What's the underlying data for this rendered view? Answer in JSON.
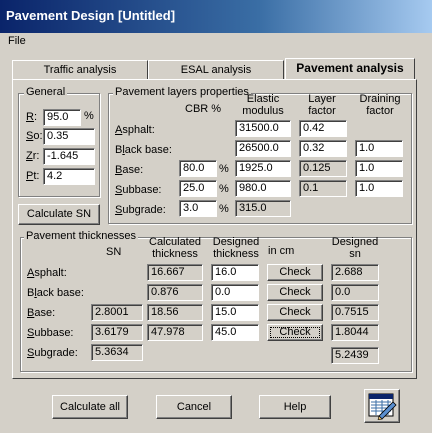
{
  "window": {
    "title": "Pavement Design [Untitled]"
  },
  "menu": {
    "file": "File"
  },
  "tabs": [
    "Traffic analysis",
    "ESAL analysis",
    "Pavement analysis"
  ],
  "general": {
    "title": "General",
    "fields": [
      {
        "label": "R:",
        "value": "95.0",
        "unit": "%"
      },
      {
        "label": "So:",
        "value": "0.35"
      },
      {
        "label": "Zr:",
        "value": "-1.645"
      },
      {
        "label": "Pt:",
        "value": "4.2"
      }
    ],
    "calc_sn_button": "Calculate SN"
  },
  "layers": {
    "title": "Pavement layers properties",
    "headers": {
      "cbr": "CBR %",
      "elastic": "Elastic modulus",
      "layer_factor": "Layer factor",
      "draining_factor": "Draining factor"
    },
    "rows": [
      {
        "name": "Asphalt:",
        "cbr": "",
        "elastic": "31500.0",
        "layer_factor": "0.42",
        "draining": ""
      },
      {
        "name": "Black base:",
        "cbr": "",
        "elastic": "26500.0",
        "layer_factor": "0.32",
        "draining": "1.0"
      },
      {
        "name": "Base:",
        "cbr": "80.0",
        "elastic": "1925.0",
        "layer_factor": "0.125",
        "draining": "1.0"
      },
      {
        "name": "Subbase:",
        "cbr": "25.0",
        "elastic": "980.0",
        "layer_factor": "0.1",
        "draining": "1.0"
      },
      {
        "name": "Subgrade:",
        "cbr": "3.0",
        "elastic": "315.0",
        "layer_factor": "",
        "draining": ""
      }
    ],
    "pct": "%"
  },
  "thickness": {
    "title": "Pavement thicknesses",
    "headers": {
      "sn": "SN",
      "calc": "Calculated thickness",
      "designed": "Designed thickness",
      "incm": "in cm",
      "designed_sn": "Designed sn"
    },
    "rows": [
      {
        "name": "Asphalt:",
        "sn": "",
        "calc": "16.667",
        "designed": "16.0",
        "check": "Check",
        "dsn": "2.688"
      },
      {
        "name": "Black base:",
        "sn": "",
        "calc": "0.876",
        "designed": "0.0",
        "check": "Check",
        "dsn": "0.0"
      },
      {
        "name": "Base:",
        "sn": "2.8001",
        "calc": "18.56",
        "designed": "15.0",
        "check": "Check",
        "dsn": "0.7515"
      },
      {
        "name": "Subbase:",
        "sn": "3.6179",
        "calc": "47.978",
        "designed": "45.0",
        "check": "Check",
        "dsn": "1.8044"
      },
      {
        "name": "Subgrade:",
        "sn": "5.3634",
        "calc": "",
        "designed": "",
        "check": "",
        "dsn": ""
      }
    ],
    "total_sn": "5.2439"
  },
  "buttons": {
    "calculate_all": "Calculate all",
    "cancel": "Cancel",
    "help": "Help"
  },
  "icons": {
    "report": "report-pencil-icon"
  }
}
